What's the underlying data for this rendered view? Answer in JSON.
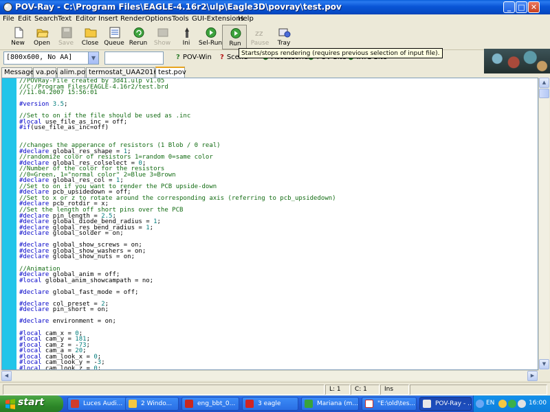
{
  "window": {
    "title": "POV-Ray - C:\\Program Files\\EAGLE-4.16r2\\ulp\\Eagle3D\\povray\\test.pov"
  },
  "menu": [
    "File",
    "Edit",
    "Search",
    "Text",
    "Editor",
    "Insert",
    "Render",
    "Options",
    "Tools",
    "GUI-Extensions",
    "Help"
  ],
  "toolbar": {
    "new": "New",
    "open": "Open",
    "save": "Save",
    "close": "Close",
    "queue": "Queue",
    "rerun": "Rerun",
    "show": "Show",
    "ini": "Ini",
    "selrun": "Sel-Run",
    "run": "Run",
    "pause": "Pause",
    "tray": "Tray"
  },
  "toolbar2": {
    "resolution": "[800x600, No AA]",
    "command": "",
    "povwin": "POV-Win",
    "scene": "Scene",
    "accessories": "Accessories",
    "povsite": "POV Site",
    "irtc": "IRTC Site"
  },
  "tooltip": "Starts/stops rendering (requires previous selection of input file).",
  "tabs": [
    "Messages",
    "va.pov",
    "alim.pov",
    "termostat_UAA2016.pov",
    "test.pov"
  ],
  "active_tab": "test.pov",
  "code_lines": [
    "//POVRay-File created by 3d41.ulp v1.05",
    "//C:/Program Files/EAGLE-4.16r2/test.brd",
    "//11.04.2007 15:56:01",
    "",
    "#version 3.5;",
    "",
    "//Set to on if the file should be used as .inc",
    "#local use_file_as_inc = off;",
    "#if(use_file_as_inc=off)",
    "",
    "",
    "//changes the apperance of resistors (1 Blob / 0 real)",
    "#declare global_res_shape = 1;",
    "//randomize color of resistors 1=random 0=same color",
    "#declare global_res_colselect = 0;",
    "//Number of the color for the resistors",
    "//0=Green, 1=\"normal color\" 2=Blue 3=Brown",
    "#declare global_res_col = 1;",
    "//Set to on if you want to render the PCB upside-down",
    "#declare pcb_upsidedown = off;",
    "//Set to x or z to rotate around the corresponding axis (referring to pcb_upsidedown)",
    "#declare pcb_rotdir = x;",
    "//Set the length off short pins over the PCB",
    "#declare pin_length = 2.5;",
    "#declare global_diode_bend_radius = 1;",
    "#declare global_res_bend_radius = 1;",
    "#declare global_solder = on;",
    "",
    "#declare global_show_screws = on;",
    "#declare global_show_washers = on;",
    "#declare global_show_nuts = on;",
    "",
    "//Animation",
    "#declare global_anim = off;",
    "#local global_anim_showcampath = no;",
    "",
    "#declare global_fast_mode = off;",
    "",
    "#declare col_preset = 2;",
    "#declare pin_short = on;",
    "",
    "#declare environment = on;",
    "",
    "#local cam_x = 0;",
    "#local cam_y = 181;",
    "#local cam_z = -73;",
    "#local cam_a = 20;",
    "#local cam_look_x = 0;",
    "#local cam_look_y = -3;",
    "#local cam_look_z = 0;"
  ],
  "status": {
    "line": "L: 1",
    "col": "C: 1",
    "mode": "Ins"
  },
  "taskbar": {
    "start": "start",
    "tasks": [
      "Luces Audi...",
      "2 Windo...",
      "eng_bbt_0...",
      "3 eagle",
      "Mariana (m...",
      "\"E:\\old\\tes...",
      "POV-Ray - ..."
    ],
    "lang": "EN",
    "clock": "16:00"
  },
  "colors": {
    "gutter": "#22c5e9",
    "comment": "#116b11",
    "keyword": "#0000c8",
    "number": "#007c7c",
    "titlebar": "#0a56d6",
    "taskbar": "#245dd7"
  }
}
